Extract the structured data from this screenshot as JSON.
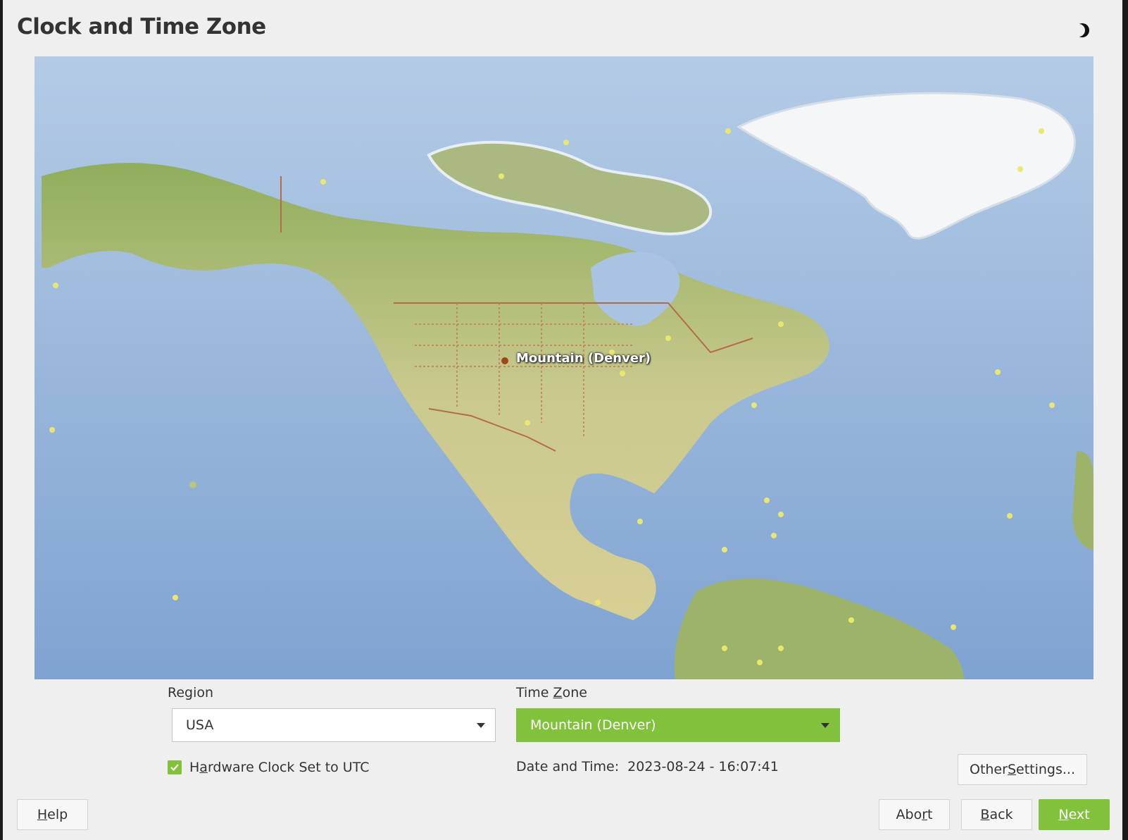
{
  "title": "Clock and Time Zone",
  "theme_toggle_icon": "half-moon-icon",
  "map": {
    "selected_label": "Mountain (Denver)",
    "colors": {
      "ocean": "#8fb0d8",
      "land": "#b7c77f",
      "ice": "#f4f6f8",
      "city_dot": "#e8e870",
      "selected_dot": "#a0441c"
    }
  },
  "region": {
    "label": "Region",
    "value": "USA"
  },
  "timezone": {
    "label_pre": "Time ",
    "label_key": "Z",
    "label_post": "one",
    "value": "Mountain (Denver)"
  },
  "hardware_clock": {
    "pre": "H",
    "key": "a",
    "post": "rdware Clock Set to UTC",
    "checked": true
  },
  "datetime": {
    "label": "Date and Time:",
    "value": "2023-08-24 - 16:07:41"
  },
  "buttons": {
    "other_settings": {
      "pre": "Other ",
      "key": "S",
      "post": "ettings..."
    },
    "help": {
      "pre": "",
      "key": "H",
      "post": "elp"
    },
    "abort": {
      "pre": "Abo",
      "key": "r",
      "post": "t"
    },
    "back": {
      "pre": "",
      "key": "B",
      "post": "ack"
    },
    "next": {
      "pre": "",
      "key": "N",
      "post": "ext"
    }
  },
  "accent_color": "#81c13b"
}
